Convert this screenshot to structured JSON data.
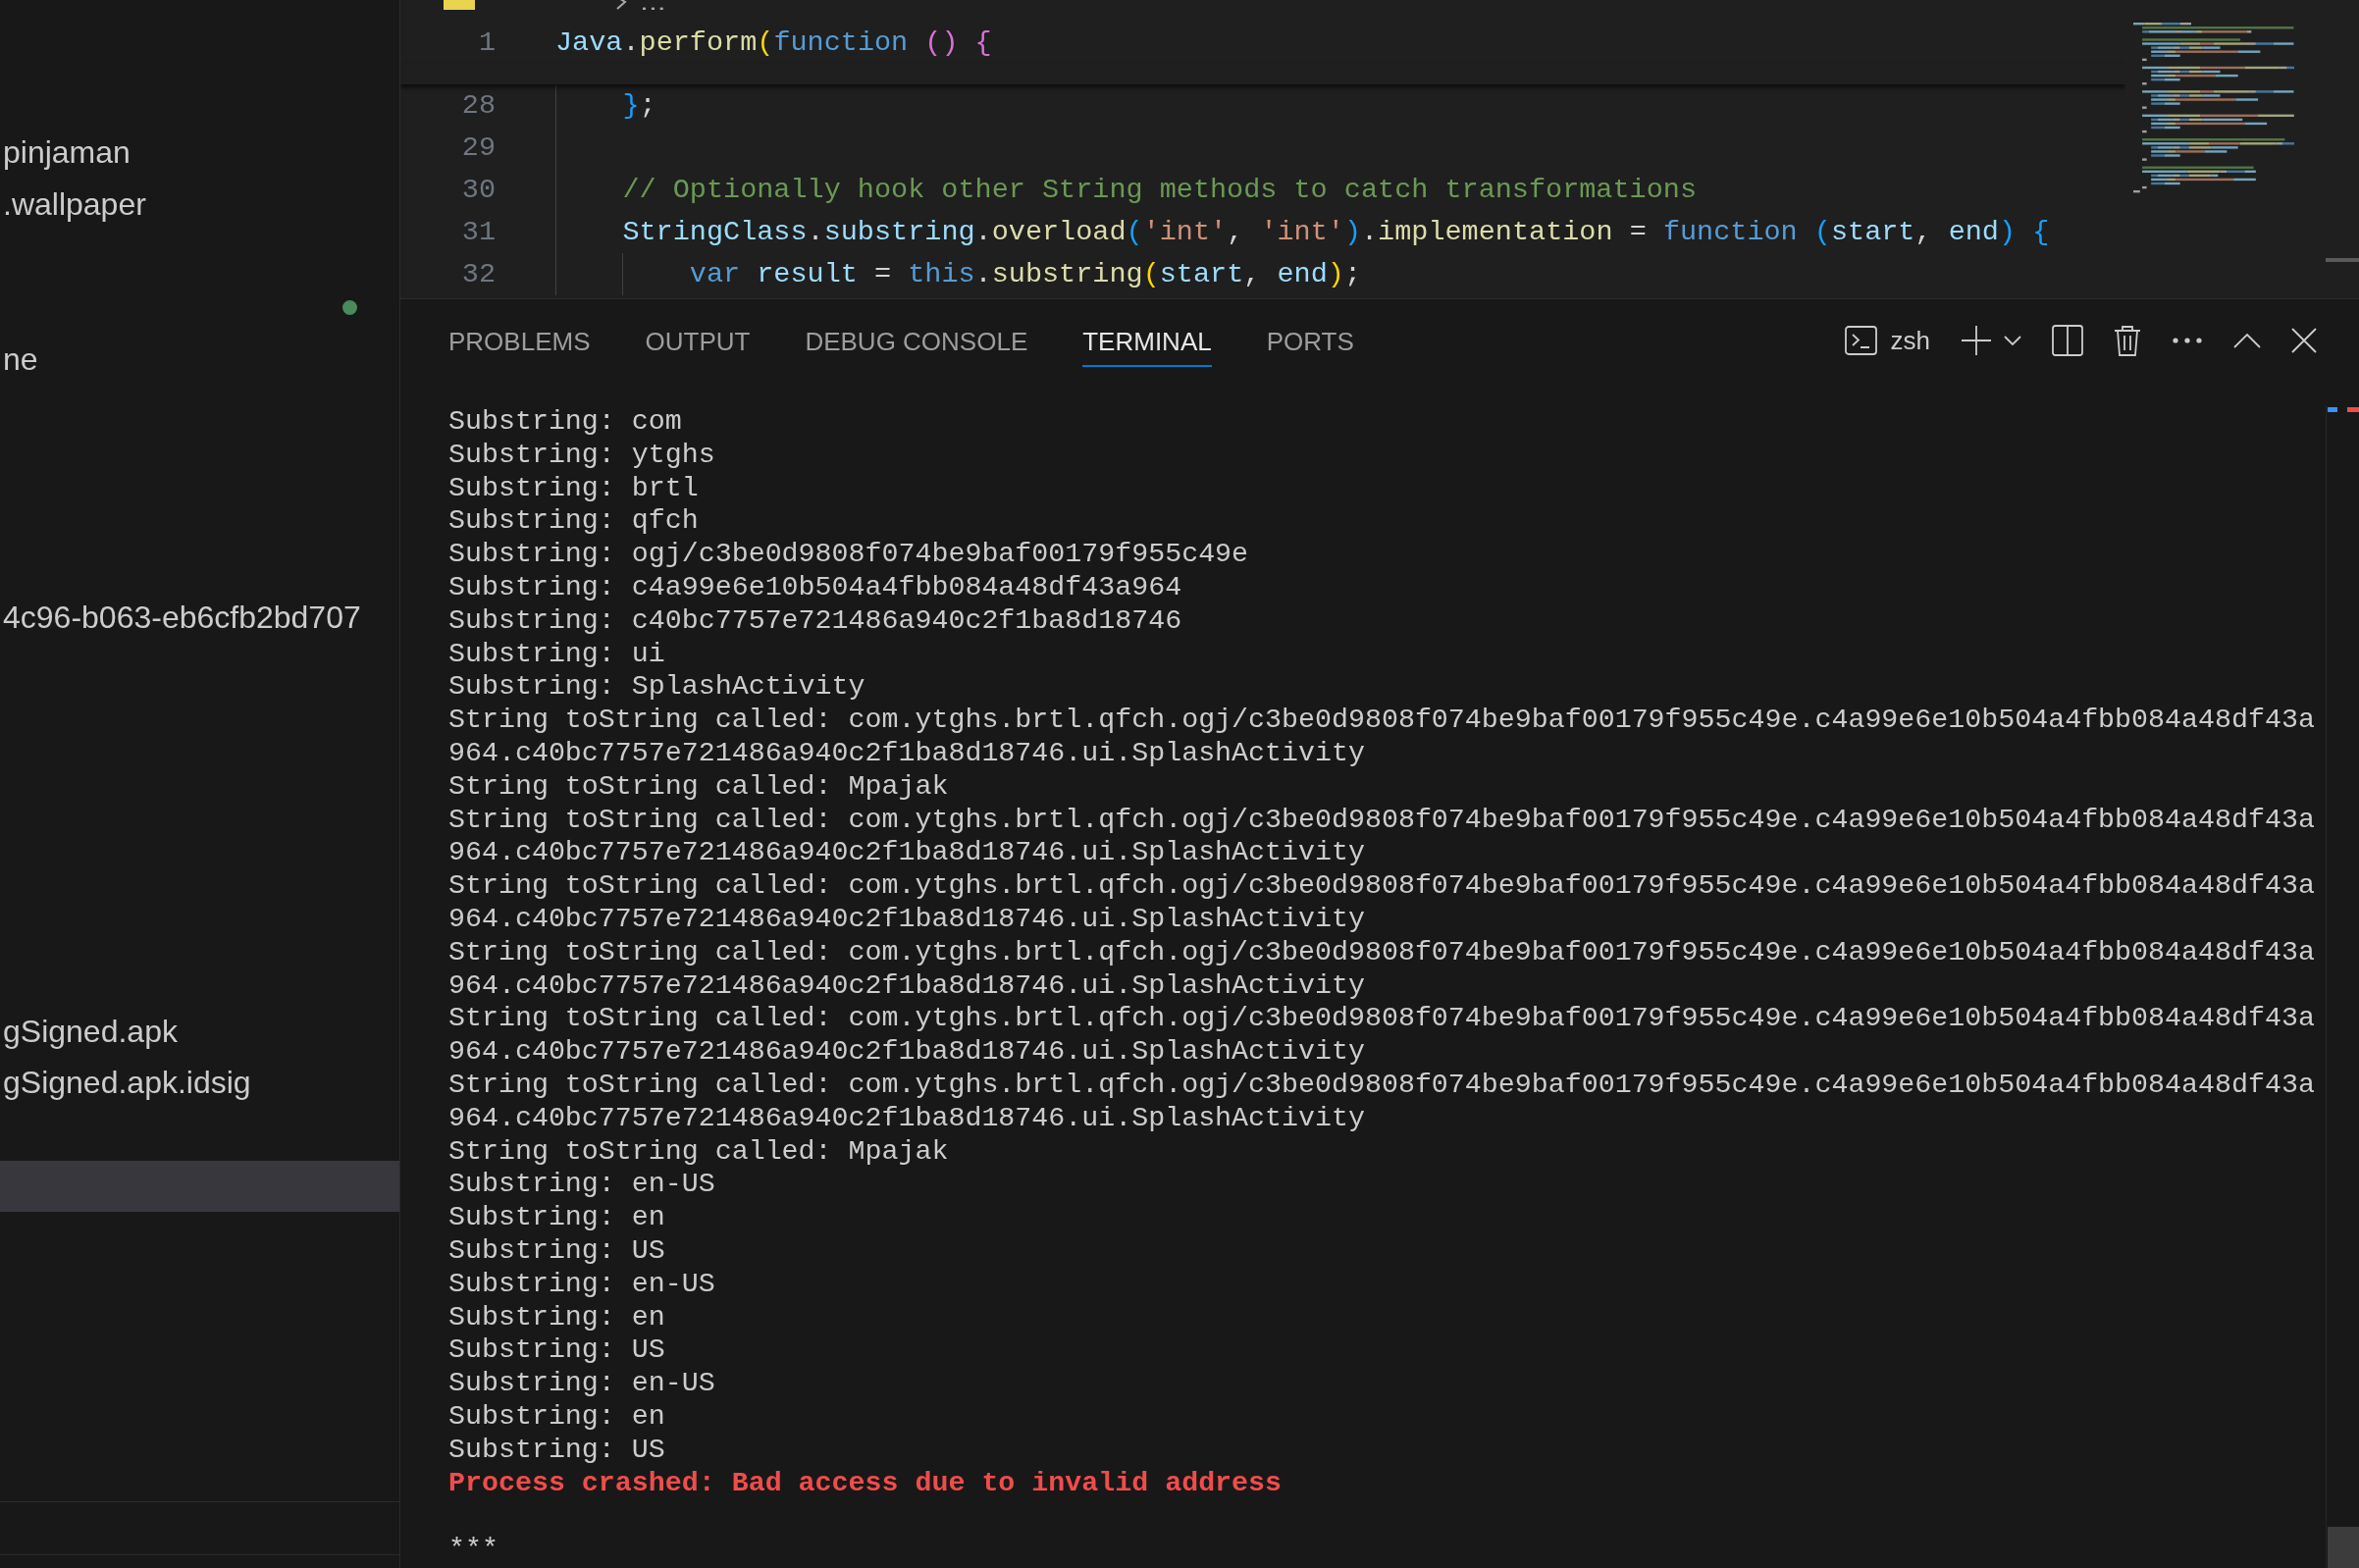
{
  "sidebar": {
    "items": [
      {
        "label": "pinjaman",
        "dot": false,
        "selected": false
      },
      {
        "label": ".wallpaper",
        "dot": false,
        "selected": false
      },
      {
        "dot": true,
        "selected": false
      },
      {
        "label": "ne",
        "dot": false,
        "selected": false
      },
      {
        "label": "4c96-b063-eb6cfb2bd707",
        "dot": false,
        "selected": false
      },
      {
        "label": "gSigned.apk",
        "dot": false,
        "selected": false
      },
      {
        "label": "gSigned.apk.idsig",
        "dot": false,
        "selected": false
      },
      {
        "dot": false,
        "selected": true
      }
    ]
  },
  "editor": {
    "breadcrumb": {
      "trail": "..."
    },
    "lines": [
      {
        "number": "1",
        "tokens": [
          {
            "text": "Java",
            "kind": "variable"
          },
          {
            "text": ".",
            "kind": "plain"
          },
          {
            "text": "perform",
            "kind": "function"
          },
          {
            "text": "(",
            "kind": "bracket1"
          },
          {
            "text": "function",
            "kind": "keyword"
          },
          {
            "text": " ()",
            "kind": "bracket2"
          },
          {
            "text": " {",
            "kind": "bracket2"
          }
        ],
        "children": [
          {
            "number": "28",
            "tokens": [
              {
                "text": "}",
                "kind": "bracket3"
              },
              {
                "text": ";",
                "kind": "plain"
              }
            ]
          },
          {
            "number": "29"
          },
          {
            "number": "30",
            "tokens": [
              {
                "text": "// Optionally hook other String methods to catch transformations",
                "kind": "comment"
              }
            ]
          },
          {
            "number": "31",
            "tokens": [
              {
                "text": "StringClass",
                "kind": "variable"
              },
              {
                "text": ".",
                "kind": "plain"
              },
              {
                "text": "substring",
                "kind": "variable"
              },
              {
                "text": ".",
                "kind": "plain"
              },
              {
                "text": "overload",
                "kind": "function"
              },
              {
                "text": "(",
                "kind": "bracket3"
              },
              {
                "text": "'int'",
                "kind": "string"
              },
              {
                "text": ", ",
                "kind": "plain"
              },
              {
                "text": "'int'",
                "kind": "string"
              },
              {
                "text": ")",
                "kind": "bracket3"
              },
              {
                "text": ".",
                "kind": "plain"
              },
              {
                "text": "implementation",
                "kind": "function"
              },
              {
                "text": " = ",
                "kind": "plain"
              },
              {
                "text": "function",
                "kind": "keyword"
              },
              {
                "text": " (",
                "kind": "bracket3"
              },
              {
                "text": "start",
                "kind": "variable"
              },
              {
                "text": ", ",
                "kind": "plain"
              },
              {
                "text": "end",
                "kind": "variable"
              },
              {
                "text": ")",
                "kind": "bracket3"
              },
              {
                "text": " {",
                "kind": "bracket3"
              }
            ],
            "children": [
              {
                "number": "32",
                "tokens": [
                  {
                    "text": "var",
                    "kind": "keyword"
                  },
                  {
                    "text": " result",
                    "kind": "variable"
                  },
                  {
                    "text": " = ",
                    "kind": "plain"
                  },
                  {
                    "text": "this",
                    "kind": "keyword"
                  },
                  {
                    "text": ".",
                    "kind": "plain"
                  },
                  {
                    "text": "substring",
                    "kind": "function"
                  },
                  {
                    "text": "(",
                    "kind": "bracket1"
                  },
                  {
                    "text": "start",
                    "kind": "variable"
                  },
                  {
                    "text": ", ",
                    "kind": "plain"
                  },
                  {
                    "text": "end",
                    "kind": "variable"
                  },
                  {
                    "text": ")",
                    "kind": "bracket1"
                  },
                  {
                    "text": ";",
                    "kind": "plain"
                  }
                ]
              }
            ]
          }
        ]
      }
    ]
  },
  "panel": {
    "tabs": [
      {
        "label": "PROBLEMS",
        "selected": false
      },
      {
        "label": "OUTPUT",
        "selected": false
      },
      {
        "label": "DEBUG CONSOLE",
        "selected": false
      },
      {
        "label": "TERMINAL",
        "selected": true
      },
      {
        "label": "PORTS",
        "selected": false
      }
    ],
    "terminal_selector": {
      "label": "zsh"
    },
    "terminal": {
      "lines": [
        {
          "kind": "output",
          "text": "Substring: com"
        },
        {
          "kind": "output",
          "text": "Substring: ytghs"
        },
        {
          "kind": "output",
          "text": "Substring: brtl"
        },
        {
          "kind": "output",
          "text": "Substring: qfch"
        },
        {
          "kind": "output",
          "text": "Substring: ogj/c3be0d9808f074be9baf00179f955c49e"
        },
        {
          "kind": "output",
          "text": "Substring: c4a99e6e10b504a4fbb084a48df43a964"
        },
        {
          "kind": "output",
          "text": "Substring: c40bc7757e721486a940c2f1ba8d18746"
        },
        {
          "kind": "output",
          "text": "Substring: ui"
        },
        {
          "kind": "output",
          "text": "Substring: SplashActivity"
        },
        {
          "kind": "output",
          "text": "String toString called: com.ytghs.brtl.qfch.ogj/c3be0d9808f074be9baf00179f955c49e.c4a99e6e10b504a4fbb084a48df43a964.c40bc7757e721486a940c2f1ba8d18746.ui.SplashActivity"
        },
        {
          "kind": "output",
          "text": "String toString called: Mpajak"
        },
        {
          "kind": "output",
          "text": "String toString called: com.ytghs.brtl.qfch.ogj/c3be0d9808f074be9baf00179f955c49e.c4a99e6e10b504a4fbb084a48df43a964.c40bc7757e721486a940c2f1ba8d18746.ui.SplashActivity"
        },
        {
          "kind": "output",
          "text": "String toString called: com.ytghs.brtl.qfch.ogj/c3be0d9808f074be9baf00179f955c49e.c4a99e6e10b504a4fbb084a48df43a964.c40bc7757e721486a940c2f1ba8d18746.ui.SplashActivity"
        },
        {
          "kind": "output",
          "text": "String toString called: com.ytghs.brtl.qfch.ogj/c3be0d9808f074be9baf00179f955c49e.c4a99e6e10b504a4fbb084a48df43a964.c40bc7757e721486a940c2f1ba8d18746.ui.SplashActivity"
        },
        {
          "kind": "output",
          "text": "String toString called: com.ytghs.brtl.qfch.ogj/c3be0d9808f074be9baf00179f955c49e.c4a99e6e10b504a4fbb084a48df43a964.c40bc7757e721486a940c2f1ba8d18746.ui.SplashActivity"
        },
        {
          "kind": "output",
          "text": "String toString called: com.ytghs.brtl.qfch.ogj/c3be0d9808f074be9baf00179f955c49e.c4a99e6e10b504a4fbb084a48df43a964.c40bc7757e721486a940c2f1ba8d18746.ui.SplashActivity"
        },
        {
          "kind": "output",
          "text": "String toString called: Mpajak"
        },
        {
          "kind": "output",
          "text": "Substring: en-US"
        },
        {
          "kind": "output",
          "text": "Substring: en"
        },
        {
          "kind": "output",
          "text": "Substring: US"
        },
        {
          "kind": "output",
          "text": "Substring: en-US"
        },
        {
          "kind": "output",
          "text": "Substring: en"
        },
        {
          "kind": "output",
          "text": "Substring: US"
        },
        {
          "kind": "output",
          "text": "Substring: en-US"
        },
        {
          "kind": "output",
          "text": "Substring: en"
        },
        {
          "kind": "output",
          "text": "Substring: US"
        },
        {
          "kind": "error",
          "text": "Process crashed: Bad access due to invalid address"
        },
        {
          "kind": "blank"
        },
        {
          "kind": "output",
          "text": "***"
        }
      ]
    }
  }
}
